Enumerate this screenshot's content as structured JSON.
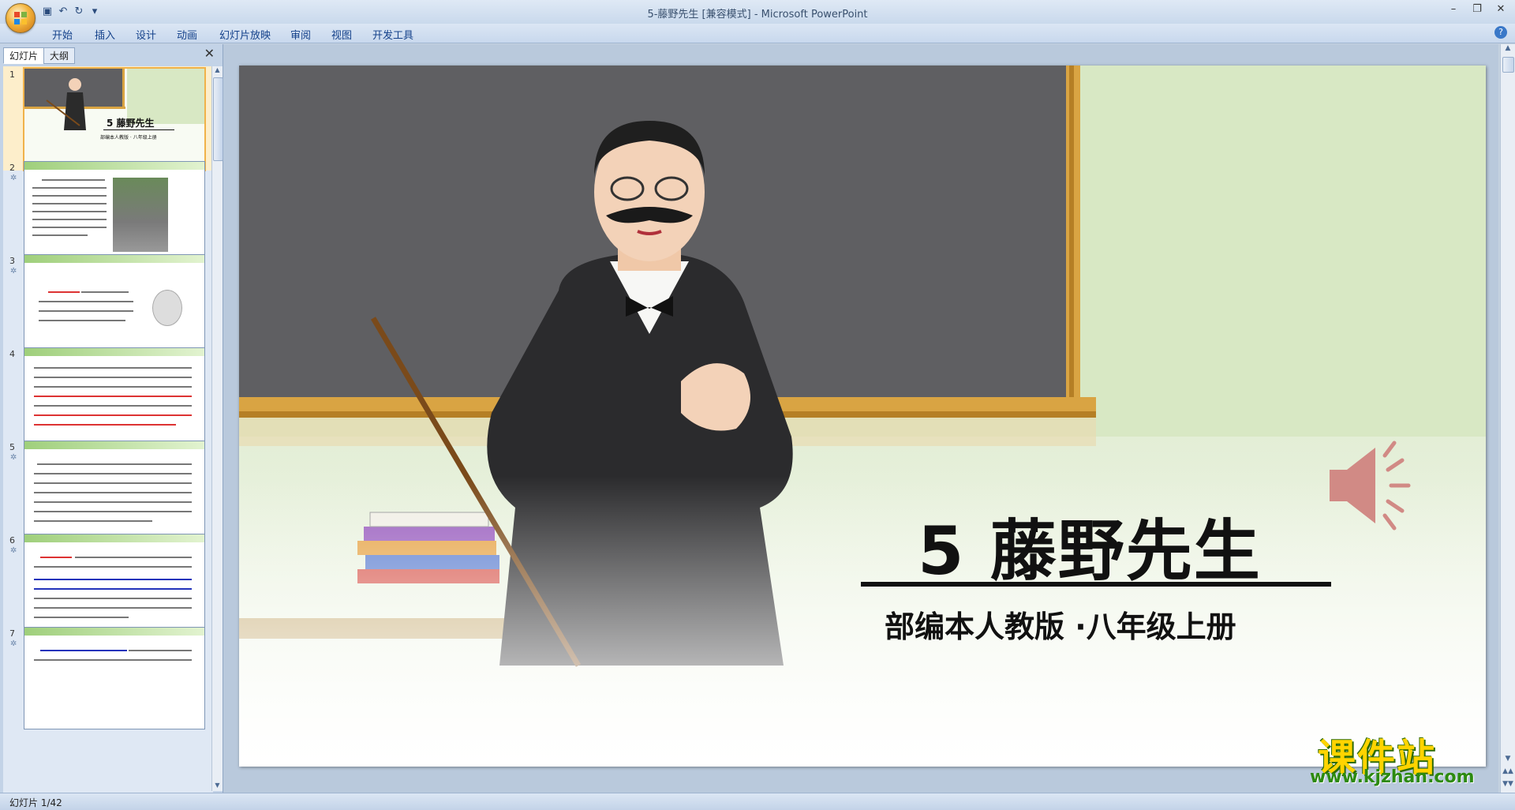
{
  "window": {
    "title": "5-藤野先生 [兼容模式] - Microsoft PowerPoint",
    "controls": [
      "minimize",
      "restore",
      "close"
    ]
  },
  "quick_access": [
    "save-icon",
    "undo-icon",
    "redo-icon",
    "customize-icon"
  ],
  "ribbon": {
    "tabs": [
      "开始",
      "插入",
      "设计",
      "动画",
      "幻灯片放映",
      "审阅",
      "视图",
      "开发工具"
    ],
    "help": "?"
  },
  "left_pane": {
    "tabs": [
      "幻灯片",
      "大纲"
    ],
    "slide_numbers": [
      "1",
      "2",
      "3",
      "4",
      "5",
      "6",
      "7"
    ],
    "thumb1_title": "5 藤野先生",
    "thumb1_sub": "部编本人教版 · 八年级上册"
  },
  "slide": {
    "title": "5  藤野先生",
    "subtitle": "部编本人教版   ·八年级上册"
  },
  "status": {
    "text": "幻灯片 1/42"
  },
  "watermark": {
    "cn": "课件站",
    "url": "www.kjzhan.com"
  },
  "colors": {
    "chalkboard": "#5f5f62",
    "frame": "#d9a443",
    "wall": "#d8e8c4",
    "accent": "#f0b24a"
  }
}
